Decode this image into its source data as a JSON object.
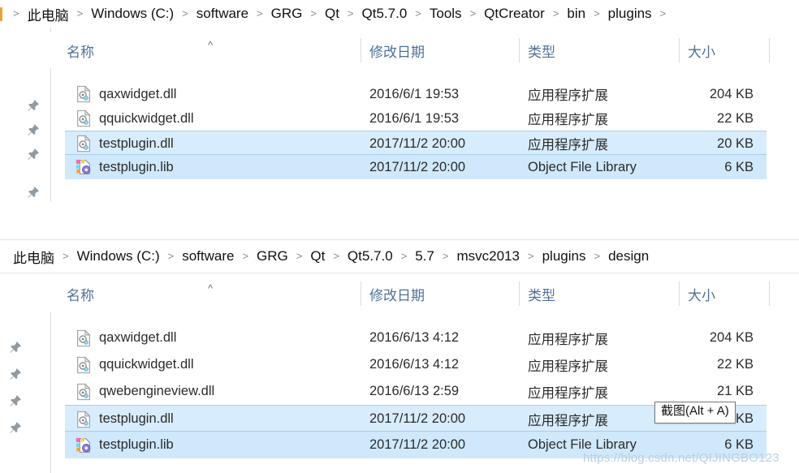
{
  "panels": [
    {
      "id": "panel-top",
      "breadcrumb": {
        "leading_separator": ">",
        "separator": ">",
        "segments": [
          "此电脑",
          "Windows (C:)",
          "software",
          "GRG",
          "Qt",
          "Qt5.7.0",
          "Tools",
          "QtCreator",
          "bin",
          "plugins"
        ]
      },
      "columns": [
        {
          "key": "name",
          "label": "名称",
          "sort_indicator": "^"
        },
        {
          "key": "date",
          "label": "修改日期"
        },
        {
          "key": "type",
          "label": "类型"
        },
        {
          "key": "size",
          "label": "大小"
        }
      ],
      "files": [
        {
          "name": "qaxwidget.dll",
          "date": "2016/6/1 19:53",
          "type": "应用程序扩展",
          "size": "204 KB",
          "icon": "dll-file-icon",
          "selected": false,
          "focused": false
        },
        {
          "name": "qquickwidget.dll",
          "date": "2016/6/1 19:53",
          "type": "应用程序扩展",
          "size": "22 KB",
          "icon": "dll-file-icon",
          "selected": false,
          "focused": false
        },
        {
          "name": "testplugin.dll",
          "date": "2017/11/2 20:00",
          "type": "应用程序扩展",
          "size": "20 KB",
          "icon": "dll-file-icon",
          "selected": true,
          "focused": true
        },
        {
          "name": "testplugin.lib",
          "date": "2017/11/2 20:00",
          "type": "Object File Library",
          "size": "6 KB",
          "icon": "lib-file-icon",
          "selected": true,
          "focused": false
        }
      ],
      "pin_count": 4
    },
    {
      "id": "panel-bottom",
      "breadcrumb": {
        "leading_separator": "",
        "separator": ">",
        "segments": [
          "此电脑",
          "Windows (C:)",
          "software",
          "GRG",
          "Qt",
          "Qt5.7.0",
          "5.7",
          "msvc2013",
          "plugins",
          "design"
        ]
      },
      "columns": [
        {
          "key": "name",
          "label": "名称",
          "sort_indicator": "^"
        },
        {
          "key": "date",
          "label": "修改日期"
        },
        {
          "key": "type",
          "label": "类型"
        },
        {
          "key": "size",
          "label": "大小"
        }
      ],
      "files": [
        {
          "name": "qaxwidget.dll",
          "date": "2016/6/13 4:12",
          "type": "应用程序扩展",
          "size": "204 KB",
          "icon": "dll-file-icon",
          "selected": false,
          "focused": false
        },
        {
          "name": "qquickwidget.dll",
          "date": "2016/6/13 4:12",
          "type": "应用程序扩展",
          "size": "22 KB",
          "icon": "dll-file-icon",
          "selected": false,
          "focused": false
        },
        {
          "name": "qwebengineview.dll",
          "date": "2016/6/13 2:59",
          "type": "应用程序扩展",
          "size": "21 KB",
          "icon": "dll-file-icon",
          "selected": false,
          "focused": false
        },
        {
          "name": "testplugin.dll",
          "date": "2017/11/2 20:00",
          "type": "应用程序扩展",
          "size": "20 KB",
          "icon": "dll-file-icon",
          "selected": true,
          "focused": true
        },
        {
          "name": "testplugin.lib",
          "date": "2017/11/2 20:00",
          "type": "Object File Library",
          "size": "6 KB",
          "icon": "lib-file-icon",
          "selected": true,
          "focused": false
        }
      ],
      "pin_count": 4
    }
  ],
  "tooltip": {
    "text": "截图(Alt + A)"
  },
  "watermark": {
    "text": "https://blog.csdn.net/QIJINGBO123"
  },
  "colors": {
    "selection": "#cfe8fb",
    "selection_border": "#a8cfe8",
    "header_text": "#4f7099",
    "accent": "#e8a33d",
    "watermark": "#b9cfe0"
  },
  "icons": {
    "pin": "pushpin-icon",
    "sort_ascending": "chevron-up-icon",
    "dll": "dll-file-icon",
    "lib": "lib-file-icon"
  }
}
